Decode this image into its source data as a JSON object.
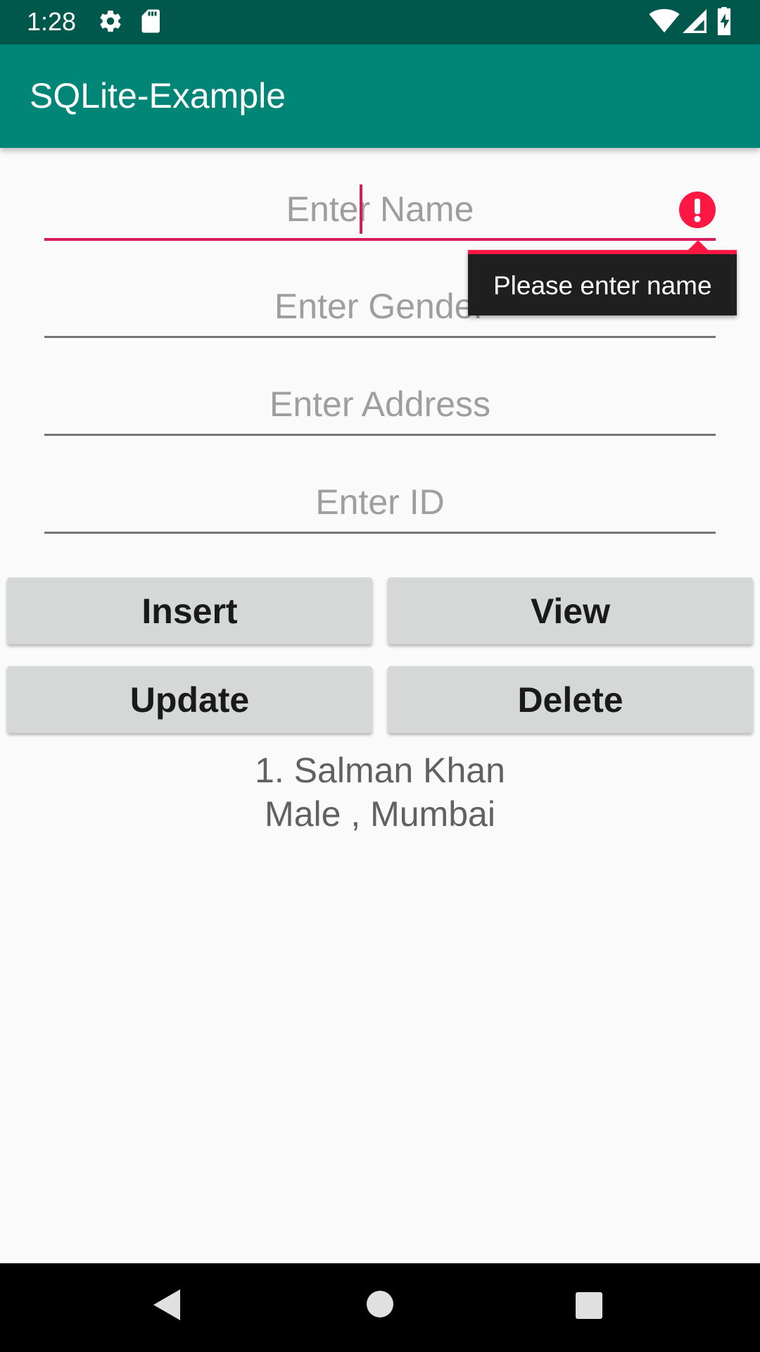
{
  "status_bar": {
    "time": "1:28",
    "icons": [
      "gear-icon",
      "sd-card-icon",
      "wifi-icon",
      "signal-icon",
      "battery-icon"
    ]
  },
  "app_bar": {
    "title": "SQLite-Example",
    "color": "#008577"
  },
  "form": {
    "name": {
      "placeholder": "Enter Name",
      "value": "",
      "error": "Please enter name"
    },
    "gender": {
      "placeholder": "Enter Gender",
      "value": ""
    },
    "address": {
      "placeholder": "Enter Address",
      "value": ""
    },
    "id": {
      "placeholder": "Enter ID",
      "value": ""
    }
  },
  "buttons": {
    "insert": "Insert",
    "view": "View",
    "update": "Update",
    "delete": "Delete"
  },
  "result": {
    "line1": "1. Salman Khan",
    "line2": "Male , Mumbai"
  },
  "colors": {
    "accent": "#d81b60",
    "error": "#ff1744",
    "status_bar": "#00574b"
  },
  "nav_bar": {
    "icons": [
      "back-icon",
      "home-icon",
      "recents-icon"
    ]
  }
}
